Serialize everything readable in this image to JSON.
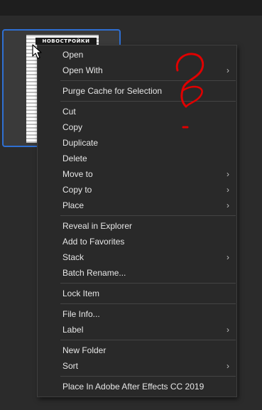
{
  "thumbnail": {
    "title_text": "НОВОСТРОЙКИ"
  },
  "context_menu": {
    "items": [
      {
        "label": "Open",
        "submenu": false
      },
      {
        "label": "Open With",
        "submenu": true
      },
      {
        "label": "Purge Cache for Selection",
        "submenu": false
      },
      {
        "label": "Cut",
        "submenu": false
      },
      {
        "label": "Copy",
        "submenu": false
      },
      {
        "label": "Duplicate",
        "submenu": false
      },
      {
        "label": "Delete",
        "submenu": false
      },
      {
        "label": "Move to",
        "submenu": true
      },
      {
        "label": "Copy to",
        "submenu": true
      },
      {
        "label": "Place",
        "submenu": true
      },
      {
        "label": "Reveal in Explorer",
        "submenu": false
      },
      {
        "label": "Add to Favorites",
        "submenu": false
      },
      {
        "label": "Stack",
        "submenu": true
      },
      {
        "label": "Batch Rename...",
        "submenu": false
      },
      {
        "label": "Lock Item",
        "submenu": false
      },
      {
        "label": "File Info...",
        "submenu": false
      },
      {
        "label": "Label",
        "submenu": true
      },
      {
        "label": "New Folder",
        "submenu": false
      },
      {
        "label": "Sort",
        "submenu": true
      },
      {
        "label": "Place In Adobe After Effects CC 2019",
        "submenu": false
      }
    ],
    "submenu_arrow": "›"
  },
  "colors": {
    "menu_bg": "#292929",
    "selection_border": "#2f6fd1",
    "annotation_red": "#e00000"
  },
  "icons": {
    "cursor": "mouse-pointer-icon",
    "submenu": "chevron-right-icon"
  }
}
